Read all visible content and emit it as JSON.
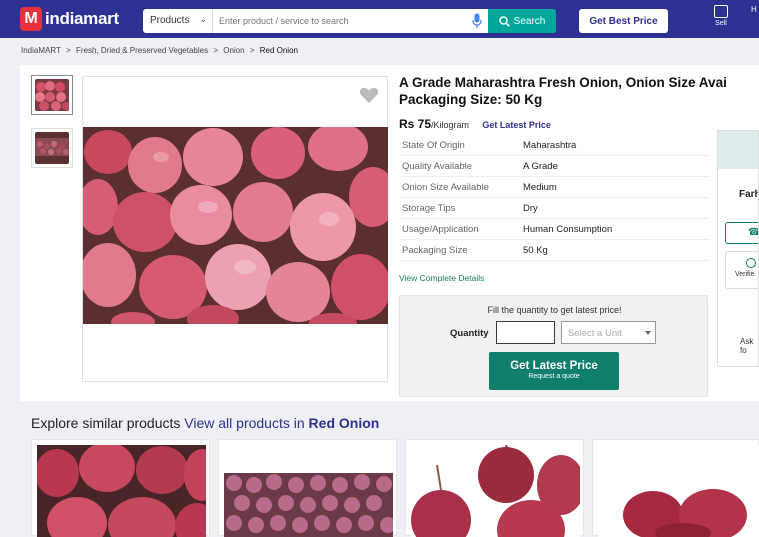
{
  "header": {
    "logo_text": "indiamart",
    "logo_letter": "M",
    "search_category": "Products",
    "search_placeholder": "Enter product / service to search",
    "search_button": "Search",
    "best_price_button": "Get Best Price",
    "sell_label": "Sell",
    "more_label": "H"
  },
  "breadcrumb": [
    "IndiaMART",
    ">",
    "Fresh, Dried & Preserved Vegetables",
    ">",
    "Onion",
    ">",
    "Red Onion"
  ],
  "product": {
    "title_line1": "A Grade Maharashtra Fresh Onion, Onion Size Avai",
    "title_line2": "Packaging Size: 50 Kg",
    "price": "Rs 75",
    "price_unit": "/Kilogram",
    "get_latest_price_link": "Get Latest Price",
    "specs": [
      {
        "key": "State Of Origin",
        "value": "Maharashtra"
      },
      {
        "key": "Quality Available",
        "value": "A Grade"
      },
      {
        "key": "Onion Size Available",
        "value": "Medium"
      },
      {
        "key": "Storage Tips",
        "value": "Dry"
      },
      {
        "key": "Usage/Application",
        "value": "Human Consumption"
      },
      {
        "key": "Packaging Size",
        "value": "50 Kg"
      }
    ],
    "view_details": "View Complete Details"
  },
  "quote": {
    "prompt": "Fill the quantity to get latest price!",
    "quantity_label": "Quantity",
    "quantity_value": "",
    "unit_placeholder": "Select a Unit",
    "button_line1": "Get Latest Price",
    "button_line2": "Request a quote"
  },
  "seller": {
    "name_partial": "Farh",
    "verified_partial": "Verifie",
    "ask_partial": "Ask fo"
  },
  "similar": {
    "prefix": "Explore similar products",
    "view_all": "View all products in",
    "category": "Red Onion"
  },
  "colors": {
    "brand_blue": "#2e3192",
    "accent_teal": "#00a699",
    "button_green": "#0f7e6d",
    "logo_red": "#e8303d"
  }
}
